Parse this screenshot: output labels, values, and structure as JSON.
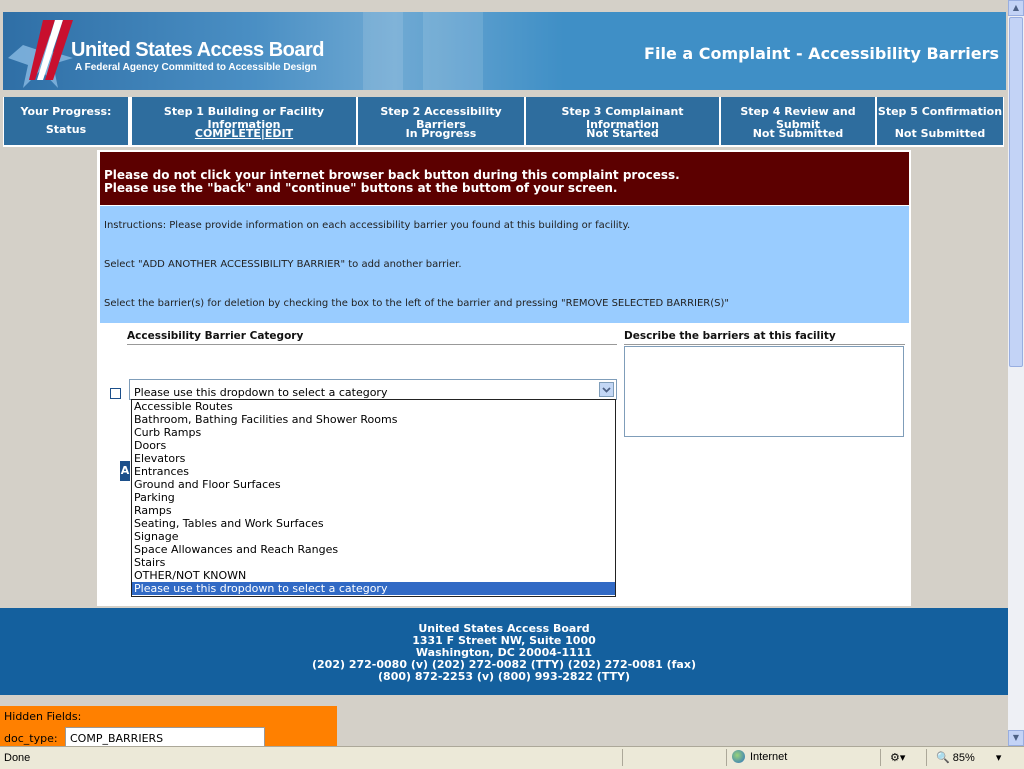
{
  "header": {
    "logo_title": "United States Access Board",
    "logo_subtitle": "A Federal Agency Committed to Accessible Design",
    "page_heading": "File a Complaint - Accessibility Barriers"
  },
  "progress": {
    "label_line1": "Your Progress:",
    "label_line2": "Status",
    "steps": [
      {
        "title": "Step 1  Building or Facility Information",
        "status": "COMPLETE|EDIT"
      },
      {
        "title": "Step 2  Accessibility Barriers",
        "status": "In Progress"
      },
      {
        "title": "Step 3  Complainant Information",
        "status": "Not Started"
      },
      {
        "title": "Step 4  Review and Submit",
        "status": "Not Submitted"
      },
      {
        "title": "Step 5   Confirmation",
        "status": "Not Submitted"
      }
    ]
  },
  "warning": {
    "line1": "Please do not click your internet browser back button during this complaint process.",
    "line2": "Please use the \"back\" and \"continue\" buttons at the buttom of your screen."
  },
  "instructions": {
    "line1": "Instructions: Please provide information on each accessibility barrier you found at this building or facility.",
    "line2": "Select \"ADD ANOTHER ACCESSIBILITY BARRIER\" to add another barrier.",
    "line3": "Select the barrier(s) for deletion by checking the box to the left of the barrier and pressing \"REMOVE SELECTED BARRIER(S)\""
  },
  "form": {
    "category_header": "Accessibility Barrier Category",
    "describe_header": "Describe the barriers at this facility",
    "select_value": "Please use this dropdown to select a category",
    "button_fragment": "A",
    "options": [
      "Accessible Routes",
      "Bathroom, Bathing Facilities and Shower Rooms",
      "Curb Ramps",
      "Doors",
      "Elevators",
      "Entrances",
      "Ground and Floor Surfaces",
      "Parking",
      "Ramps",
      "Seating, Tables and Work Surfaces",
      "Signage",
      "Space Allowances and Reach Ranges",
      "Stairs",
      "OTHER/NOT KNOWN",
      "Please use this dropdown to select a category"
    ],
    "selected_option_index": 14
  },
  "footer": {
    "org": "United States Access Board",
    "address1": "1331 F Street NW, Suite 1000",
    "address2": "Washington, DC  20004-1111",
    "phones1": "(202) 272-0080 (v)  (202) 272-0082 (TTY)  (202) 272-0081 (fax)",
    "phones2": "(800) 872-2253 (v)  (800) 993-2822 (TTY)"
  },
  "hidden_fields": {
    "label": "Hidden Fields:",
    "doc_type_label": "doc_type:",
    "doc_type_value": "COMP_BARRIERS"
  },
  "statusbar": {
    "status": "Done",
    "zone": "Internet",
    "zoom": "85%"
  },
  "colors": {
    "header_blue": "#3f8fc6",
    "progress_blue": "#2e6d9e",
    "warning_maroon": "#5c0000",
    "instructions_blue": "#99ccff",
    "footer_blue": "#14609e",
    "hidden_orange": "#ff8000",
    "selection_blue": "#316ac5"
  }
}
